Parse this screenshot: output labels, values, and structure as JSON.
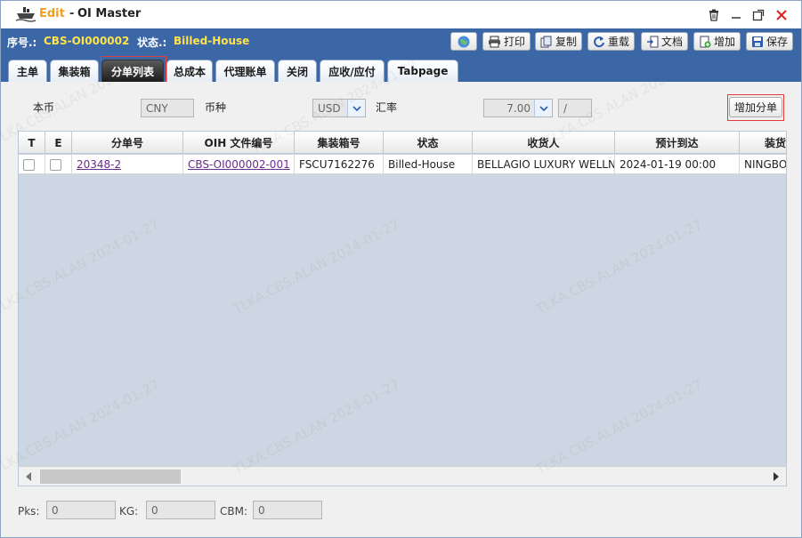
{
  "window": {
    "mode": "Edit",
    "separator": "-",
    "title": "OI Master"
  },
  "info": {
    "seq_label": "序号.:",
    "seq_value": "CBS-OI000002",
    "status_label": "状态.:",
    "status_value": "Billed-House"
  },
  "toolbar": {
    "print": "打印",
    "copy": "复制",
    "reload": "重载",
    "docs": "文档",
    "add": "增加",
    "save": "保存"
  },
  "tabs": [
    {
      "label": "主单"
    },
    {
      "label": "集装箱"
    },
    {
      "label": "分单列表"
    },
    {
      "label": "总成本"
    },
    {
      "label": "代理账单"
    },
    {
      "label": "关闭"
    },
    {
      "label": "应收/应付"
    },
    {
      "label": "Tabpage"
    }
  ],
  "currency": {
    "base_label": "本币",
    "base_value": "CNY",
    "currency_label": "币种",
    "currency_value": "USD",
    "rate_label": "汇率",
    "rate_value": "7.00",
    "rate_divider": "/",
    "add_sub_button": "增加分单"
  },
  "grid": {
    "columns": [
      "T",
      "E",
      "分单号",
      "OIH 文件编号",
      "集装箱号",
      "状态",
      "收货人",
      "预计到达",
      "装货"
    ],
    "rows": [
      {
        "hbl": "20348-2",
        "file_no": "CBS-OI000002-001",
        "container": "FSCU7162276",
        "status": "Billed-House",
        "consignee": "BELLAGIO LUXURY WELLN",
        "eta": "2024-01-19 00:00",
        "loading": "NINGBO"
      }
    ]
  },
  "footer": {
    "pks_label": "Pks:",
    "pks_value": "0",
    "kg_label": "KG:",
    "kg_value": "0",
    "cbm_label": "CBM:",
    "cbm_value": "0"
  },
  "watermark": "TLKA.CBS.ALAN 2024-01-27",
  "colors": {
    "header_blue": "#3b67a6",
    "mode_orange": "#f0a020",
    "status_yellow": "#ffe34a",
    "close_red": "#e02020",
    "link_purple": "#6b2b8c"
  }
}
